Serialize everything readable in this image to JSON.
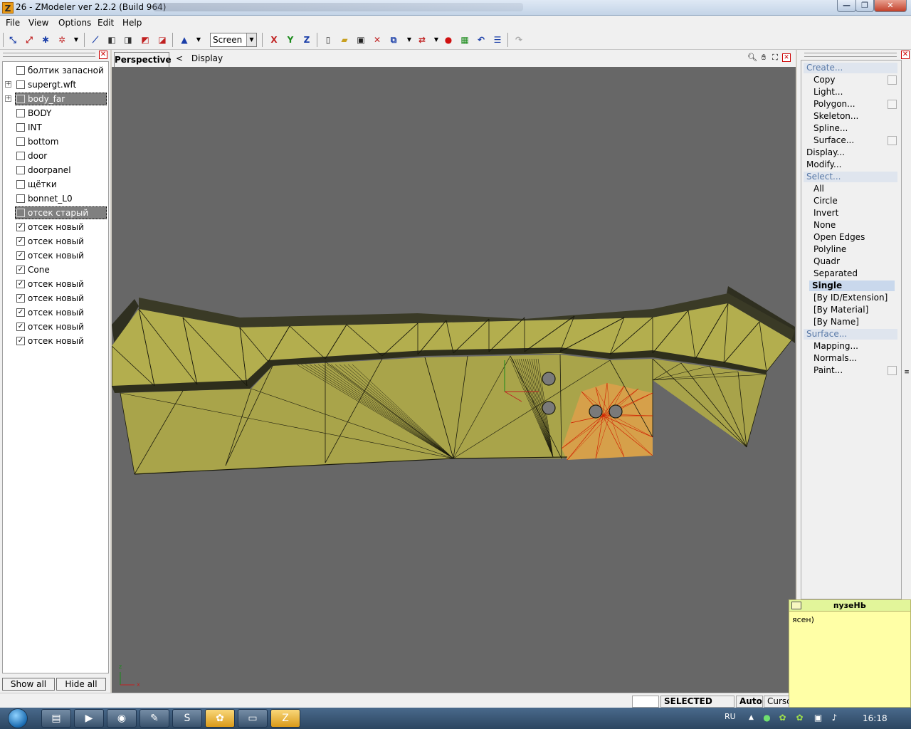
{
  "window": {
    "title": "26 - ZModeler ver 2.2.2 (Build 964)",
    "app_icon_letter": "Z",
    "buttons": {
      "minimize": "—",
      "maximize": "❐",
      "close": "✕"
    }
  },
  "menu": {
    "items": [
      "File",
      "View",
      "Options",
      "Edit",
      "Help"
    ]
  },
  "toolbar": {
    "mode_select": "Screen",
    "axis_x": "X",
    "axis_y": "Y",
    "axis_z": "Z"
  },
  "objects": {
    "items": [
      {
        "label": "болтик запасной",
        "checked": false,
        "expandable": false,
        "selected": false
      },
      {
        "label": "supergt.wft",
        "checked": false,
        "expandable": true,
        "selected": false
      },
      {
        "label": "body_far",
        "checked": false,
        "expandable": true,
        "selected": true
      },
      {
        "label": "BODY",
        "checked": false,
        "expandable": false,
        "selected": false
      },
      {
        "label": "INT",
        "checked": false,
        "expandable": false,
        "selected": false
      },
      {
        "label": "bottom",
        "checked": false,
        "expandable": false,
        "selected": false
      },
      {
        "label": "door",
        "checked": false,
        "expandable": false,
        "selected": false
      },
      {
        "label": "doorpanel",
        "checked": false,
        "expandable": false,
        "selected": false
      },
      {
        "label": "щётки",
        "checked": false,
        "expandable": false,
        "selected": false
      },
      {
        "label": "bonnet_L0",
        "checked": false,
        "expandable": false,
        "selected": false
      },
      {
        "label": "отсек старый",
        "checked": false,
        "expandable": false,
        "selected": true
      },
      {
        "label": "отсек новый",
        "checked": true,
        "expandable": false,
        "selected": false
      },
      {
        "label": "отсек новый",
        "checked": true,
        "expandable": false,
        "selected": false
      },
      {
        "label": "отсек новый",
        "checked": true,
        "expandable": false,
        "selected": false
      },
      {
        "label": "Cone",
        "checked": true,
        "expandable": false,
        "selected": false
      },
      {
        "label": "отсек новый",
        "checked": true,
        "expandable": false,
        "selected": false
      },
      {
        "label": "отсек новый",
        "checked": true,
        "expandable": false,
        "selected": false
      },
      {
        "label": "отсек новый",
        "checked": true,
        "expandable": false,
        "selected": false
      },
      {
        "label": "отсек новый",
        "checked": true,
        "expandable": false,
        "selected": false
      },
      {
        "label": "отсек новый",
        "checked": true,
        "expandable": false,
        "selected": false
      }
    ],
    "show_all": "Show all",
    "hide_all": "Hide all"
  },
  "viewport": {
    "tab": "Perspective",
    "back_arrow": "<",
    "display_label": "Display",
    "axis_x": "x",
    "axis_z": "z"
  },
  "commands": {
    "items": [
      {
        "label": "Create...",
        "kind": "section",
        "box": false
      },
      {
        "label": "Copy",
        "kind": "sub",
        "box": true
      },
      {
        "label": "Light...",
        "kind": "sub",
        "box": false
      },
      {
        "label": "Polygon...",
        "kind": "sub",
        "box": true
      },
      {
        "label": "Skeleton...",
        "kind": "sub",
        "box": false
      },
      {
        "label": "Spline...",
        "kind": "sub",
        "box": false
      },
      {
        "label": "Surface...",
        "kind": "sub",
        "box": true
      },
      {
        "label": "Display...",
        "kind": "top",
        "box": false
      },
      {
        "label": "Modify...",
        "kind": "top",
        "box": false
      },
      {
        "label": "Select...",
        "kind": "section",
        "box": false
      },
      {
        "label": "All",
        "kind": "sub",
        "box": false
      },
      {
        "label": "Circle",
        "kind": "sub",
        "box": false
      },
      {
        "label": "Invert",
        "kind": "sub",
        "box": false
      },
      {
        "label": "None",
        "kind": "sub",
        "box": false
      },
      {
        "label": "Open Edges",
        "kind": "sub",
        "box": false
      },
      {
        "label": "Polyline",
        "kind": "sub",
        "box": false
      },
      {
        "label": "Quadr",
        "kind": "sub",
        "box": false
      },
      {
        "label": "Separated",
        "kind": "sub",
        "box": false
      },
      {
        "label": "Single",
        "kind": "active",
        "box": false
      },
      {
        "label": "[By ID/Extension]",
        "kind": "sub",
        "box": false
      },
      {
        "label": "[By Material]",
        "kind": "sub",
        "box": false
      },
      {
        "label": "[By Name]",
        "kind": "sub",
        "box": false
      },
      {
        "label": "Surface...",
        "kind": "section",
        "box": false
      },
      {
        "label": "Mapping...",
        "kind": "sub",
        "box": false
      },
      {
        "label": "Normals...",
        "kind": "sub",
        "box": false
      },
      {
        "label": "Paint...",
        "kind": "sub",
        "box": true
      }
    ]
  },
  "chat": {
    "name": "пузеНЬ",
    "message": "ясен)"
  },
  "status": {
    "mode": "SELECTED MODE",
    "auto": "Auto",
    "cursor": "Cursor"
  },
  "taskbar": {
    "language": "RU",
    "clock": "16:18"
  },
  "colors": {
    "viewport_bg": "#676767",
    "mesh_fill": "#b0ab4c",
    "mesh_selected": "#d6a04a",
    "wire": "#1a1a0c",
    "wire_selected": "#d02000"
  }
}
